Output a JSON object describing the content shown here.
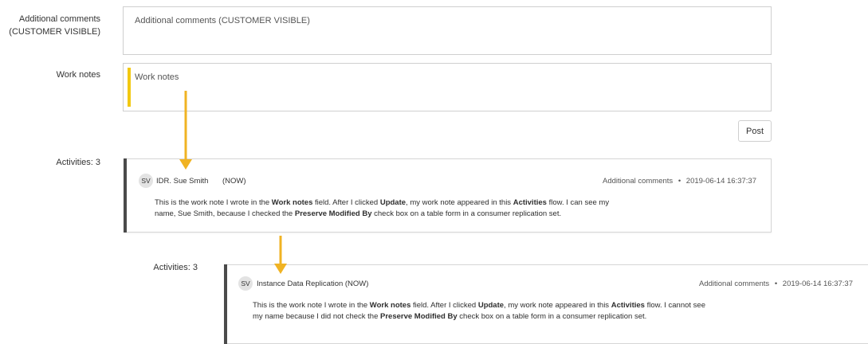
{
  "form": {
    "additional_comments": {
      "label_line1": "Additional comments",
      "label_line2": "(CUSTOMER VISIBLE)",
      "placeholder": "Additional comments (CUSTOMER VISIBLE)"
    },
    "work_notes": {
      "label": "Work notes",
      "placeholder": "Work notes"
    },
    "post_label": "Post"
  },
  "activities": [
    {
      "heading": "Activities: 3",
      "avatar_initials": "SV",
      "author": "IDR. Sue Smith",
      "when": "(NOW)",
      "entry_type": "Additional comments",
      "separator": "•",
      "timestamp": "2019-06-14 16:37:37",
      "body": {
        "line1_a": "This is the work note I wrote in the ",
        "line1_b": "Work notes",
        "line1_c": " field. After I clicked ",
        "line1_d": "Update",
        "line1_e": ", my work note appeared in this ",
        "line1_f": "Activities",
        "line1_g": " flow. I can see my",
        "line2_a": "name, Sue Smith, because I checked the ",
        "line2_b": "Preserve Modified By",
        "line2_c": " check box on a table form in a consumer replication set."
      }
    },
    {
      "heading": "Activities: 3",
      "avatar_initials": "SV",
      "author": "Instance Data Replication (NOW)",
      "entry_type": "Additional comments",
      "separator": "•",
      "timestamp": "2019-06-14 16:37:37",
      "body": {
        "line1_a": "This is the work note I wrote in the ",
        "line1_b": "Work notes",
        "line1_c": " field. After I clicked ",
        "line1_d": "Update",
        "line1_e": ", my work note appeared in this ",
        "line1_f": "Activities",
        "line1_g": " flow. I cannot see",
        "line2_a": "my name because I did not check the ",
        "line2_b": "Preserve Modified By",
        "line2_c": " check box on a table form in a consumer replication set."
      }
    }
  ],
  "colors": {
    "accent_yellow": "#f2c811",
    "arrow": "#f0b323",
    "card_bar": "#4a4a4a"
  }
}
